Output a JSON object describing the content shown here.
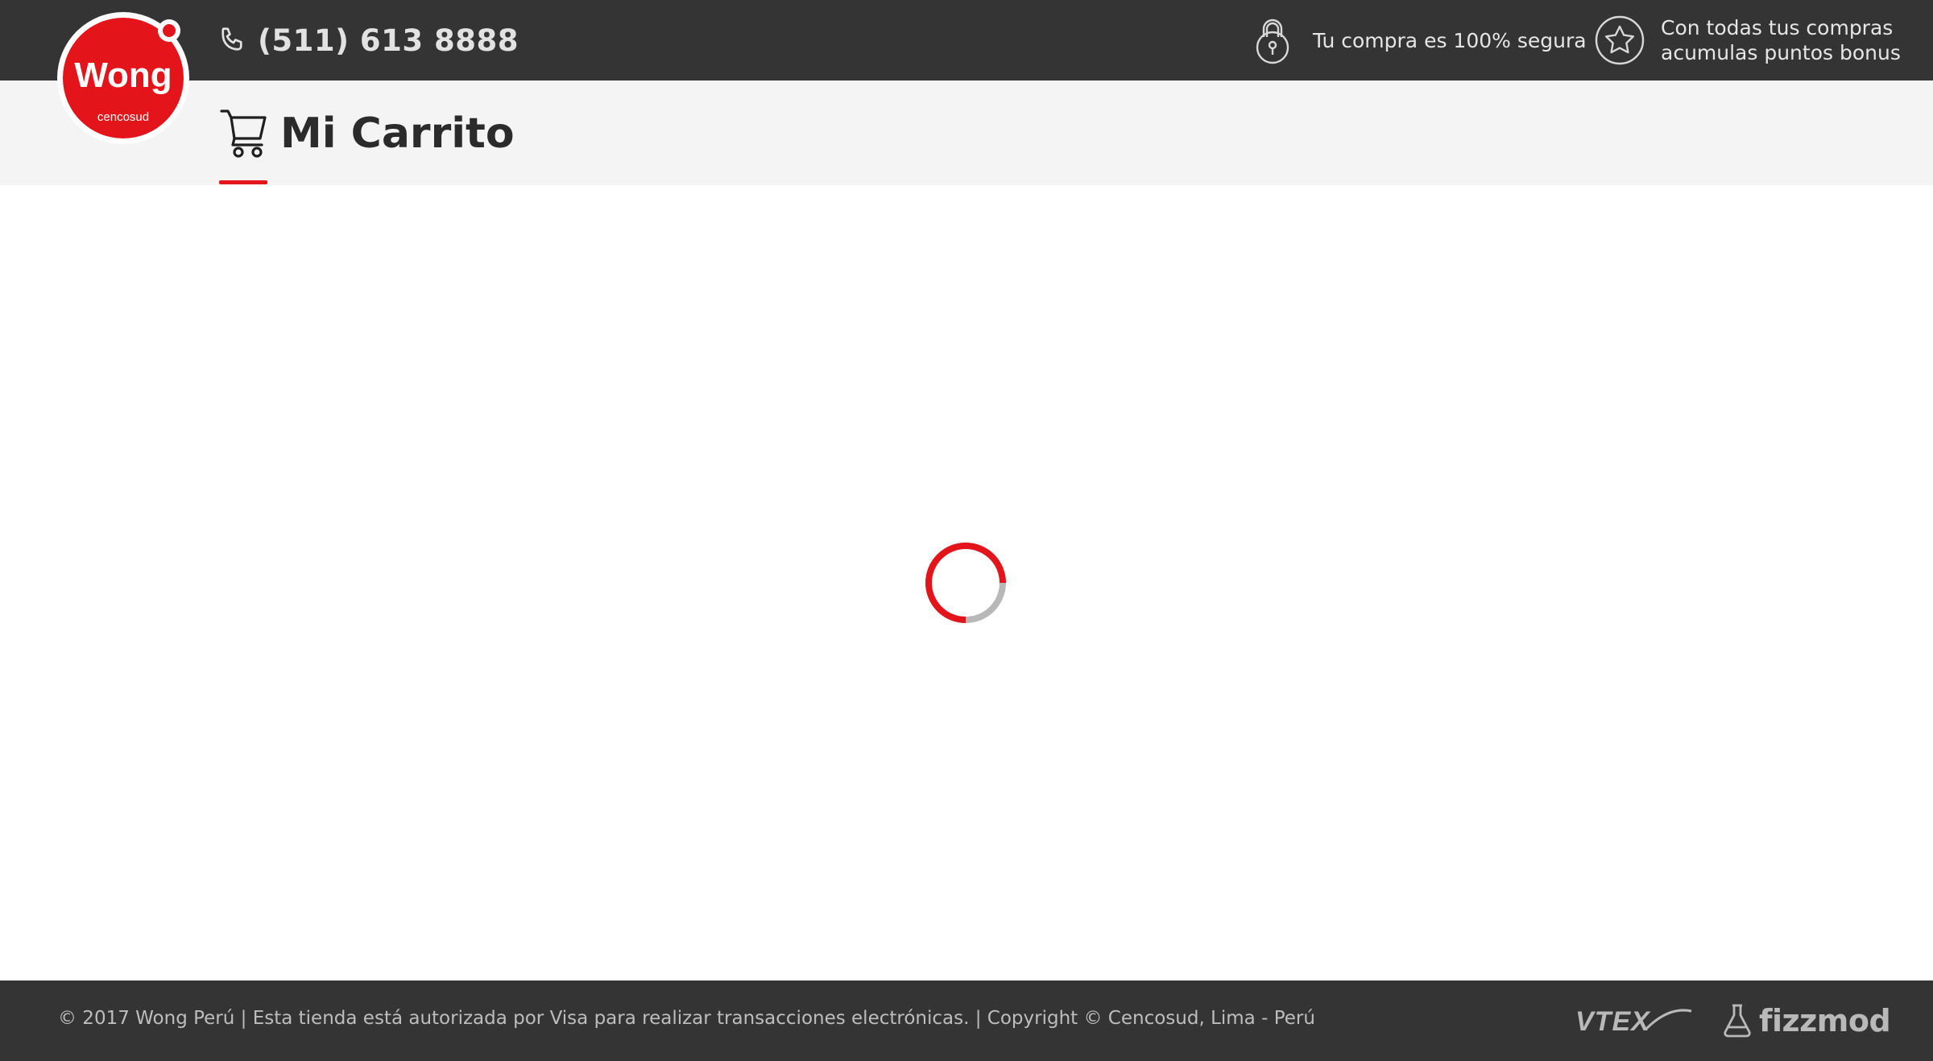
{
  "header": {
    "logo_text": "Wong",
    "logo_subtext": "cencosud",
    "phone": "(511) 613 8888",
    "secure_text": "Tu compra es 100% segura",
    "bonus_line1": "Con todas tus compras",
    "bonus_line2": "acumulas puntos bonus"
  },
  "page": {
    "title": "Mi Carrito"
  },
  "footer": {
    "copyright": "© 2017 Wong Perú | Esta tienda está autorizada por Visa para realizar transacciones electrónicas. | Copyright © Cencosud, Lima - Perú",
    "vtex_logo_text": "VTEX",
    "fizzmod_logo_text": "fizzmod"
  },
  "icons": {
    "phone": "phone-icon",
    "lock": "lock-icon",
    "star": "star-icon",
    "cart": "cart-icon",
    "spinner": "loading-spinner"
  },
  "colors": {
    "brand_red": "#e3151b",
    "dark_bar": "#343434",
    "light_bar": "#f4f4f4"
  }
}
